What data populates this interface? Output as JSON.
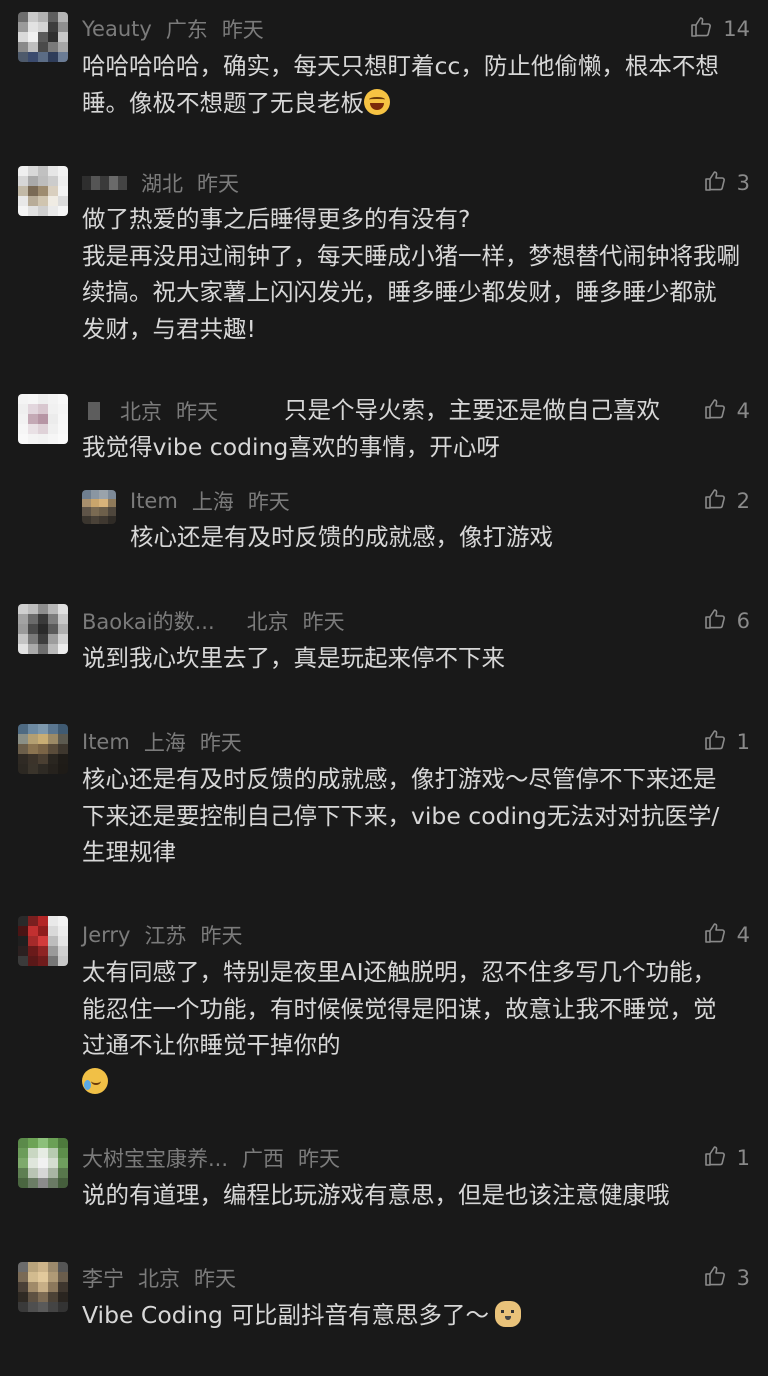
{
  "comments": [
    {
      "name": "Yeauty",
      "location": "广东",
      "time": "昨天",
      "likes": "14",
      "lines": [
        "哈哈哈哈哈，确实，每天只想盯着cc，防止他偷懒，根本不想",
        "睡。像极不想题了无良老板"
      ],
      "emoji": "laugh-cry-emoji"
    },
    {
      "name": "",
      "location": "湖北",
      "time": "昨天",
      "likes": "3",
      "lines": [
        "做了热爱的事之后睡得更多的有没有?",
        "我是再没用过闹钟了，每天睡成小猪一样，梦想替代闹钟将我唰",
        "续搞。祝大家薯上闪闪发光，睡多睡少都发财，睡多睡少都就",
        "发财，与君共趣!"
      ]
    },
    {
      "name": "",
      "location": "北京",
      "time": "昨天",
      "likes": "4",
      "inline_text": "只是个导火索，主要还是做自己喜欢",
      "lines": [
        "我觉得vibe coding喜欢的事情，开心呀"
      ]
    },
    {
      "reply": true,
      "name": "Item",
      "location": "上海",
      "time": "昨天",
      "likes": "2",
      "lines": [
        "核心还是有及时反馈的成就感，像打游戏"
      ]
    },
    {
      "name": "Baokai的数...",
      "location": "北京",
      "time": "昨天",
      "likes": "6",
      "lines": [
        "说到我心坎里去了，真是玩起来停不下来"
      ]
    },
    {
      "name": "Item",
      "location": "上海",
      "time": "昨天",
      "likes": "1",
      "lines": [
        "核心还是有及时反馈的成就感，像打游戏～尽管停不下来还是",
        "下来还是要控制自己停下下来，vibe coding无法对对抗医学/",
        "生理规律"
      ]
    },
    {
      "name": "Jerry",
      "location": "江苏",
      "time": "昨天",
      "likes": "4",
      "lines": [
        "太有同感了，特别是夜里AI还触脱明，忍不住多写几个功能，",
        "能忍住一个功能，有时候候觉得是阳谋，故意让我不睡觉，觉",
        "过通不让你睡觉干掉你的"
      ],
      "emoji_line": "crying-emoji"
    },
    {
      "name": "大树宝宝康养...",
      "location": "广西",
      "time": "昨天",
      "likes": "1",
      "lines": [
        "说的有道理，编程比玩游戏有意思，但是也该注意健康哦"
      ]
    },
    {
      "name": "李宁",
      "location": "北京",
      "time": "昨天",
      "likes": "3",
      "lines": [
        "Vibe Coding 可比副抖音有意思多了～"
      ],
      "emoji": "doge-emoji"
    }
  ],
  "colors": {
    "background": "#191919",
    "meta": "#7b7b7b",
    "body": "#d7d7d7",
    "like": "#8a8a8a"
  },
  "icons": {
    "like": "thumbs-up-icon"
  }
}
